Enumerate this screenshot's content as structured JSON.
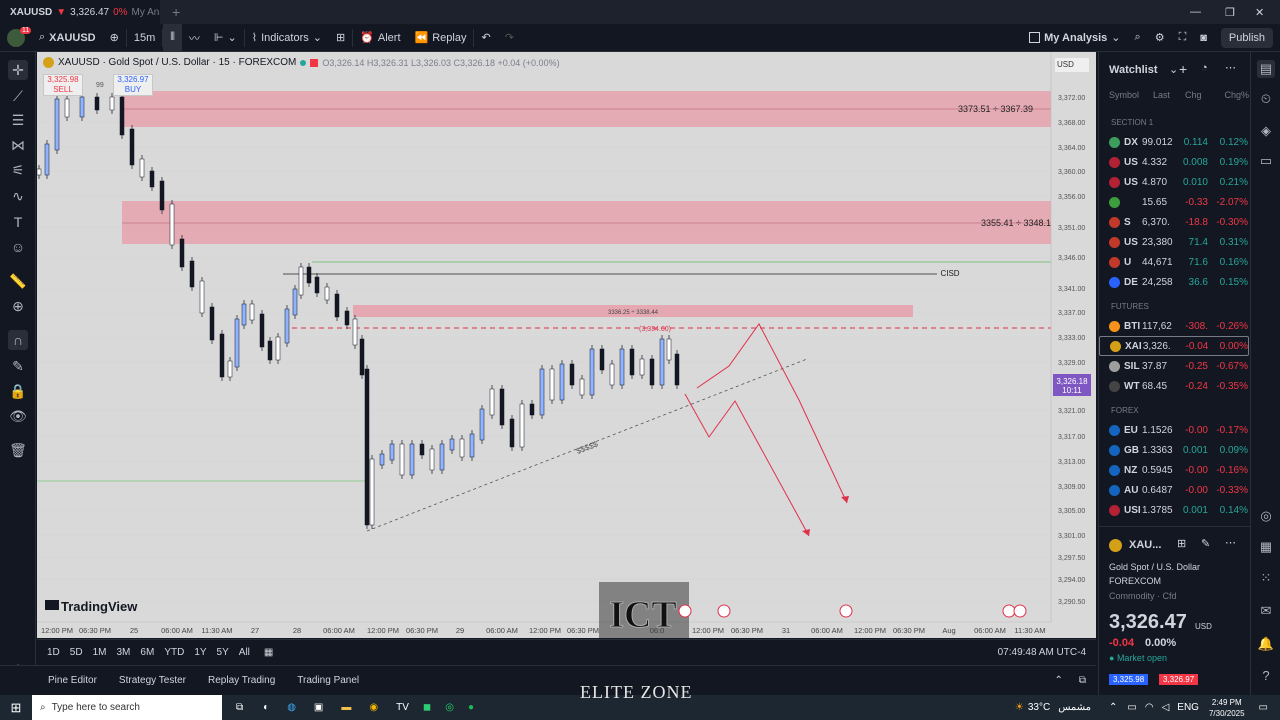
{
  "browser_tab": {
    "title": "XAUUSD",
    "arrow": "▼",
    "price": "3,326.47",
    "change": "0%",
    "page": "My Anal"
  },
  "toolbar": {
    "symbol": "XAUUSD",
    "interval": "15m",
    "indicators": "Indicators",
    "alert": "Alert",
    "replay": "Replay",
    "layout": "My Analysis",
    "publish": "Publish",
    "notification_count": "11"
  },
  "legend": {
    "title": "XAUUSD · Gold Spot / U.S. Dollar · 15 · FOREXCOM",
    "ohlc": "O3,326.14 H3,326.31 L3,326.03 C3,326.18 +0.04 (+0.00%)",
    "currency": "USD"
  },
  "trade": {
    "sell_price": "3,325.98",
    "sell_label": "SELL",
    "buy_price": "3,326.97",
    "buy_label": "BUY",
    "spread": "99"
  },
  "chart_labels": {
    "zone1": "3373.51 ÷ 3367.39",
    "zone2": "3355.41 ÷ 3348.1",
    "zone3": "3336.25 ÷ 3338.44",
    "dashed": "(3,334.60)",
    "cisd": "CISD",
    "trendline": "$$$$$",
    "watermark": "TradingView",
    "brand": "ELITE ZONE",
    "logo": "ICT"
  },
  "price_axis": [
    "3,372.00",
    "3,368.00",
    "3,364.00",
    "3,360.00",
    "3,356.00",
    "3,351.00",
    "3,346.00",
    "3,341.00",
    "3,337.00",
    "3,333.00",
    "3,329.00",
    "3,321.00",
    "3,317.00",
    "3,313.00",
    "3,309.00",
    "3,305.00",
    "3,301.00",
    "3,297.50",
    "3,294.00",
    "3,290.50"
  ],
  "current_price": {
    "value": "3,326.18",
    "countdown": "10:11"
  },
  "time_axis": [
    "12:00 PM",
    "06:30 PM",
    "25",
    "06:00 AM",
    "11:30 AM",
    "27",
    "28",
    "06:00 AM",
    "12:00 PM",
    "06:30 PM",
    "29",
    "06:00 AM",
    "12:00 PM",
    "06:30 PM",
    "06:0",
    "12:00 PM",
    "06:30 PM",
    "31",
    "06:00 AM",
    "12:00 PM",
    "06:30 PM",
    "Aug",
    "06:00 AM",
    "11:30 AM"
  ],
  "ranges": [
    "1D",
    "5D",
    "1M",
    "3M",
    "6M",
    "YTD",
    "1Y",
    "5Y",
    "All"
  ],
  "clock": "07:49:48 AM UTC-4",
  "panels": [
    "Pine Editor",
    "Strategy Tester",
    "Replay Trading",
    "Trading Panel"
  ],
  "watchlist": {
    "title": "Watchlist",
    "cols": [
      "Symbol",
      "Last",
      "Chg",
      "Chg%"
    ],
    "sections": [
      "SECTION 1",
      "FUTURES",
      "FOREX"
    ],
    "rows": [
      {
        "sym": "DX",
        "last": "99.012",
        "chg": "0.114",
        "pct": "0.12%",
        "dir": "up",
        "icon": "#3c9d5c"
      },
      {
        "sym": "US",
        "last": "4.332",
        "chg": "0.008",
        "pct": "0.19%",
        "dir": "up",
        "icon": "#b22234"
      },
      {
        "sym": "US",
        "last": "4.870",
        "chg": "0.010",
        "pct": "0.21%",
        "dir": "up",
        "icon": "#b22234"
      },
      {
        "sym": "",
        "last": "15.65",
        "chg": "-0.33",
        "pct": "-2.07%",
        "dir": "down",
        "icon": "#3c9d3c"
      },
      {
        "sym": "S",
        "last": "6,370.",
        "chg": "-18.8",
        "pct": "-0.30%",
        "dir": "down",
        "icon": "#c0392b"
      },
      {
        "sym": "US",
        "last": "23,380",
        "chg": "71.4",
        "pct": "0.31%",
        "dir": "up",
        "icon": "#c0392b"
      },
      {
        "sym": "U",
        "last": "44,671",
        "chg": "71.6",
        "pct": "0.16%",
        "dir": "up",
        "icon": "#c0392b"
      },
      {
        "sym": "DE",
        "last": "24,258",
        "chg": "36.6",
        "pct": "0.15%",
        "dir": "up",
        "icon": "#2962ff"
      },
      {
        "sym": "BTI",
        "last": "117,62",
        "chg": "-308.",
        "pct": "-0.26%",
        "dir": "down",
        "icon": "#f7931a"
      },
      {
        "sym": "XAI",
        "last": "3,326.",
        "chg": "-0.04",
        "pct": "0.00%",
        "dir": "down",
        "icon": "#d4a017"
      },
      {
        "sym": "SIL",
        "last": "37.87",
        "chg": "-0.25",
        "pct": "-0.67%",
        "dir": "down",
        "icon": "#9e9e9e"
      },
      {
        "sym": "WT",
        "last": "68.45",
        "chg": "-0.24",
        "pct": "-0.35%",
        "dir": "down",
        "icon": "#444"
      },
      {
        "sym": "EU",
        "last": "1.1526",
        "chg": "-0.00",
        "pct": "-0.17%",
        "dir": "down",
        "icon": "#1565c0"
      },
      {
        "sym": "GB",
        "last": "1.3363",
        "chg": "0.001",
        "pct": "0.09%",
        "dir": "up",
        "icon": "#1565c0"
      },
      {
        "sym": "NZ",
        "last": "0.5945",
        "chg": "-0.00",
        "pct": "-0.16%",
        "dir": "down",
        "icon": "#1565c0"
      },
      {
        "sym": "AU",
        "last": "0.6487",
        "chg": "-0.00",
        "pct": "-0.33%",
        "dir": "down",
        "icon": "#1565c0"
      },
      {
        "sym": "USI",
        "last": "1.3785",
        "chg": "0.001",
        "pct": "0.14%",
        "dir": "up",
        "icon": "#b22234"
      }
    ]
  },
  "details": {
    "sym": "XAU...",
    "name": "Gold Spot / U.S. Dollar",
    "exchange": "FOREXCOM",
    "type": "Commodity · Cfd",
    "price": "3,326.47",
    "currency": "USD",
    "change": "-0.04",
    "pct": "0.00%",
    "status": "Market open",
    "bid": "3,325.98",
    "ask": "3,326.97"
  },
  "taskbar": {
    "search": "Type here to search",
    "weather": "33°C",
    "weather_label": "مشمس",
    "lang": "ENG",
    "time": "2:49 PM",
    "date": "7/30/2025"
  },
  "colors": {
    "up": "#26a69a",
    "down": "#f23645",
    "zone": "#e8a0aa",
    "accent": "#2962ff"
  }
}
